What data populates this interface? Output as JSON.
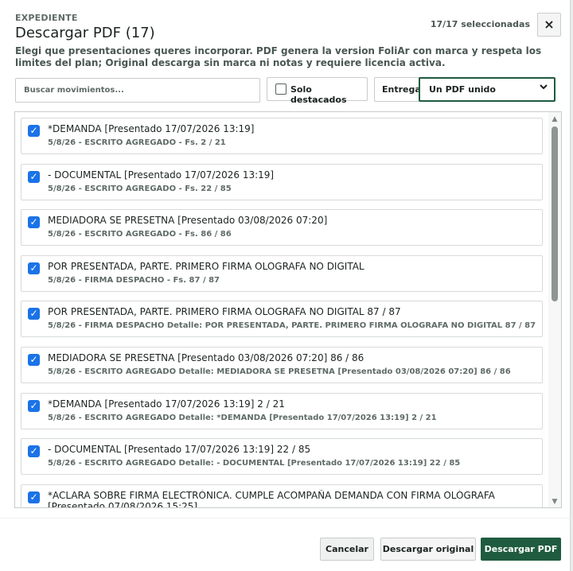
{
  "header": {
    "kicker": "EXPEDIENTE",
    "title": "Descargar PDF (17)",
    "selected_count": "17/17 seleccionadas",
    "close_label": "×",
    "description": "Elegi que presentaciones queres incorporar. PDF genera la version FoliAr con marca y respeta los limites del plan; Original descarga sin marca ni notas y requiere licencia activa."
  },
  "controls": {
    "search_placeholder": "Buscar movimientos...",
    "featured_label": "Solo destacados",
    "featured_checked": false,
    "delivery_label": "Entrega",
    "delivery_value": "Un PDF unido"
  },
  "items": [
    {
      "title": "*DEMANDA [Presentado 17/07/2026 13:19]",
      "subtitle": "5/8/26 - ESCRITO AGREGADO - Fs. 2 / 21",
      "checked": true
    },
    {
      "title": "- DOCUMENTAL [Presentado 17/07/2026 13:19]",
      "subtitle": "5/8/26 - ESCRITO AGREGADO - Fs. 22 / 85",
      "checked": true
    },
    {
      "title": "MEDIADORA SE PRESETNA [Presentado 03/08/2026 07:20]",
      "subtitle": "5/8/26 - ESCRITO AGREGADO - Fs. 86 / 86",
      "checked": true
    },
    {
      "title": "POR PRESENTADA, PARTE. PRIMERO FIRMA OLOGRAFA NO DIGITAL",
      "subtitle": "5/8/26 - FIRMA DESPACHO - Fs. 87 / 87",
      "checked": true
    },
    {
      "title": "POR PRESENTADA, PARTE. PRIMERO FIRMA OLOGRAFA NO DIGITAL 87 / 87",
      "subtitle": "5/8/26 - FIRMA DESPACHO Detalle: POR PRESENTADA, PARTE. PRIMERO FIRMA OLOGRAFA NO DIGITAL 87 / 87",
      "checked": true
    },
    {
      "title": "MEDIADORA SE PRESETNA [Presentado 03/08/2026 07:20] 86 / 86",
      "subtitle": "5/8/26 - ESCRITO AGREGADO Detalle: MEDIADORA SE PRESETNA [Presentado 03/08/2026 07:20] 86 / 86",
      "checked": true
    },
    {
      "title": "*DEMANDA [Presentado 17/07/2026 13:19] 2 / 21",
      "subtitle": "5/8/26 - ESCRITO AGREGADO Detalle: *DEMANDA [Presentado 17/07/2026 13:19] 2 / 21",
      "checked": true
    },
    {
      "title": "- DOCUMENTAL [Presentado 17/07/2026 13:19] 22 / 85",
      "subtitle": "5/8/26 - ESCRITO AGREGADO Detalle: - DOCUMENTAL [Presentado 17/07/2026 13:19] 22 / 85",
      "checked": true
    },
    {
      "title": "*ACLARA SOBRE FIRMA ELECTRÓNICA. CUMPLE ACOMPAÑA DEMANDA CON FIRMA OLÓGRAFA [Presentado 07/08/2026 15:25]",
      "subtitle": "",
      "checked": true
    }
  ],
  "footer": {
    "cancel_label": "Cancelar",
    "original_label": "Descargar original",
    "pdf_label": "Descargar PDF"
  }
}
